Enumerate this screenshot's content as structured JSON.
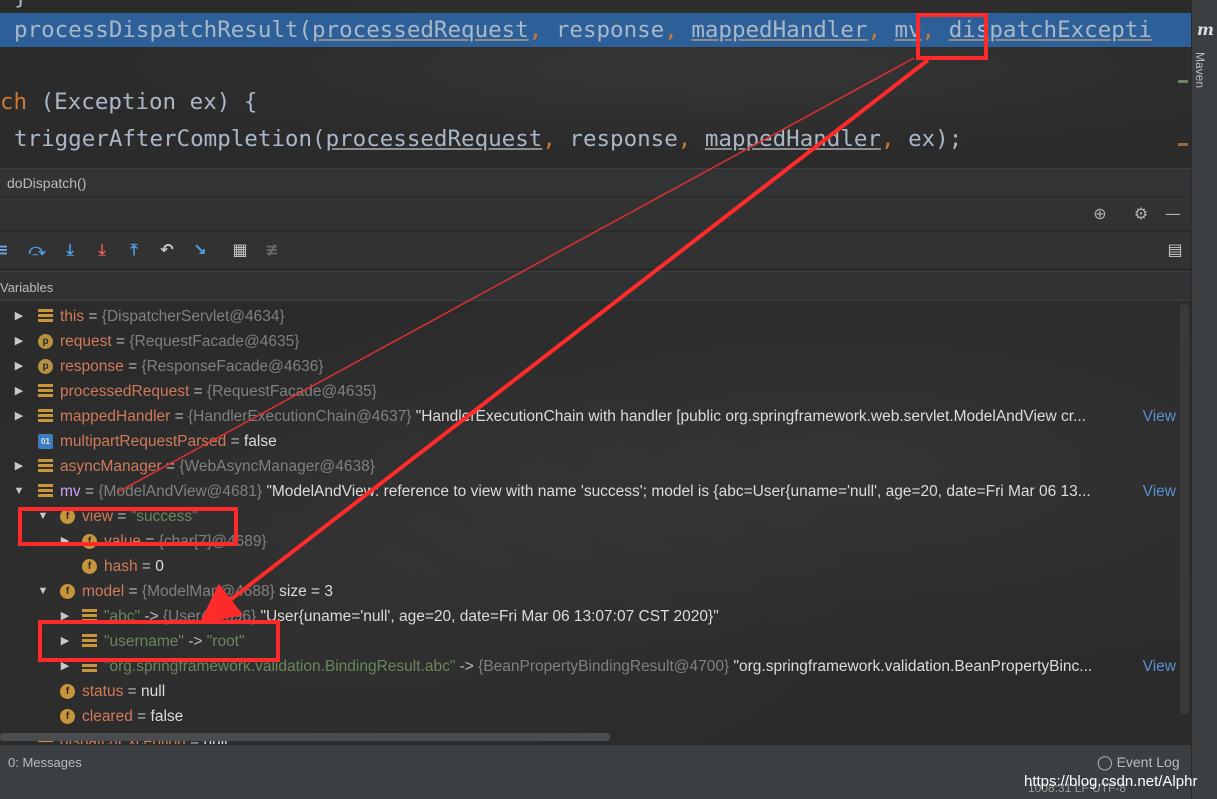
{
  "editor": {
    "line0": "}",
    "line1": {
      "fn": "processDispatchResult(",
      "a1": "processedRequest",
      "a2": "response",
      "a3": "mappedHandler",
      "a4": "mv",
      "a5": "dispatchExcepti"
    },
    "line2": {
      "kw": "ch",
      "rest": " (Exception ex) {"
    },
    "line3": {
      "fn": "triggerAfterCompletion(",
      "a1": "processedRequest",
      "a2": "response",
      "a3": "mappedHandler",
      "a4": "ex);"
    }
  },
  "breadcrumb": "doDispatch()",
  "right_strip": {
    "icon": "m",
    "label": "Maven"
  },
  "variables_title": "Variables",
  "tree": [
    {
      "name": "this",
      "ref": "{DispatcherServlet@4634}"
    },
    {
      "name": "request",
      "ref": "{RequestFacade@4635}"
    },
    {
      "name": "response",
      "ref": "{ResponseFacade@4636}"
    },
    {
      "name": "processedRequest",
      "ref": "{RequestFacade@4635}"
    },
    {
      "name": "mappedHandler",
      "ref": "{HandlerExecutionChain@4637}",
      "val": "\"HandlerExecutionChain with handler [public org.springframework.web.servlet.ModelAndView cr...",
      "link": "View"
    },
    {
      "name": "multipartRequestParsed",
      "val": "false"
    },
    {
      "name": "asyncManager",
      "ref": "{WebAsyncManager@4638}"
    },
    {
      "name": "mv",
      "ref": "{ModelAndView@4681}",
      "val": "\"ModelAndView: reference to view with name 'success'; model is {abc=User{uname='null', age=20, date=Fri Mar 06 13...",
      "link": "View"
    },
    {
      "name": "view",
      "str": "\"success\""
    },
    {
      "name": "value",
      "ref": "{char[7]@4689}"
    },
    {
      "name": "hash",
      "val": "0"
    },
    {
      "name": "model",
      "ref": "{ModelMap@4688}",
      "val": "size = 3"
    },
    {
      "name": "\"abc\"",
      "arrow": "->",
      "ref": "{User@4696}",
      "val": "\"User{uname='null', age=20, date=Fri Mar 06 13:07:07 CST 2020}\""
    },
    {
      "name": "\"username\"",
      "arrow": "->",
      "str": "\"root\""
    },
    {
      "name": "\"org.springframework.validation.BindingResult.abc\"",
      "arrow": "->",
      "ref": "{BeanPropertyBindingResult@4700}",
      "val": "\"org.springframework.validation.BeanPropertyBinc...",
      "link": "View"
    },
    {
      "name": "status",
      "val": "null"
    },
    {
      "name": "cleared",
      "val": "false"
    },
    {
      "name": "dispatchException",
      "val": "null"
    }
  ],
  "statusbar": {
    "messages": "0: Messages",
    "event_log": "Event Log",
    "position": "1008:31   LF   UTF-8",
    "watermark": "https://blog.csdn.net/Alphr"
  },
  "colors": {
    "selection": "#2d6099",
    "annotation": "#ff2a2a",
    "link": "#5a8fd0"
  }
}
